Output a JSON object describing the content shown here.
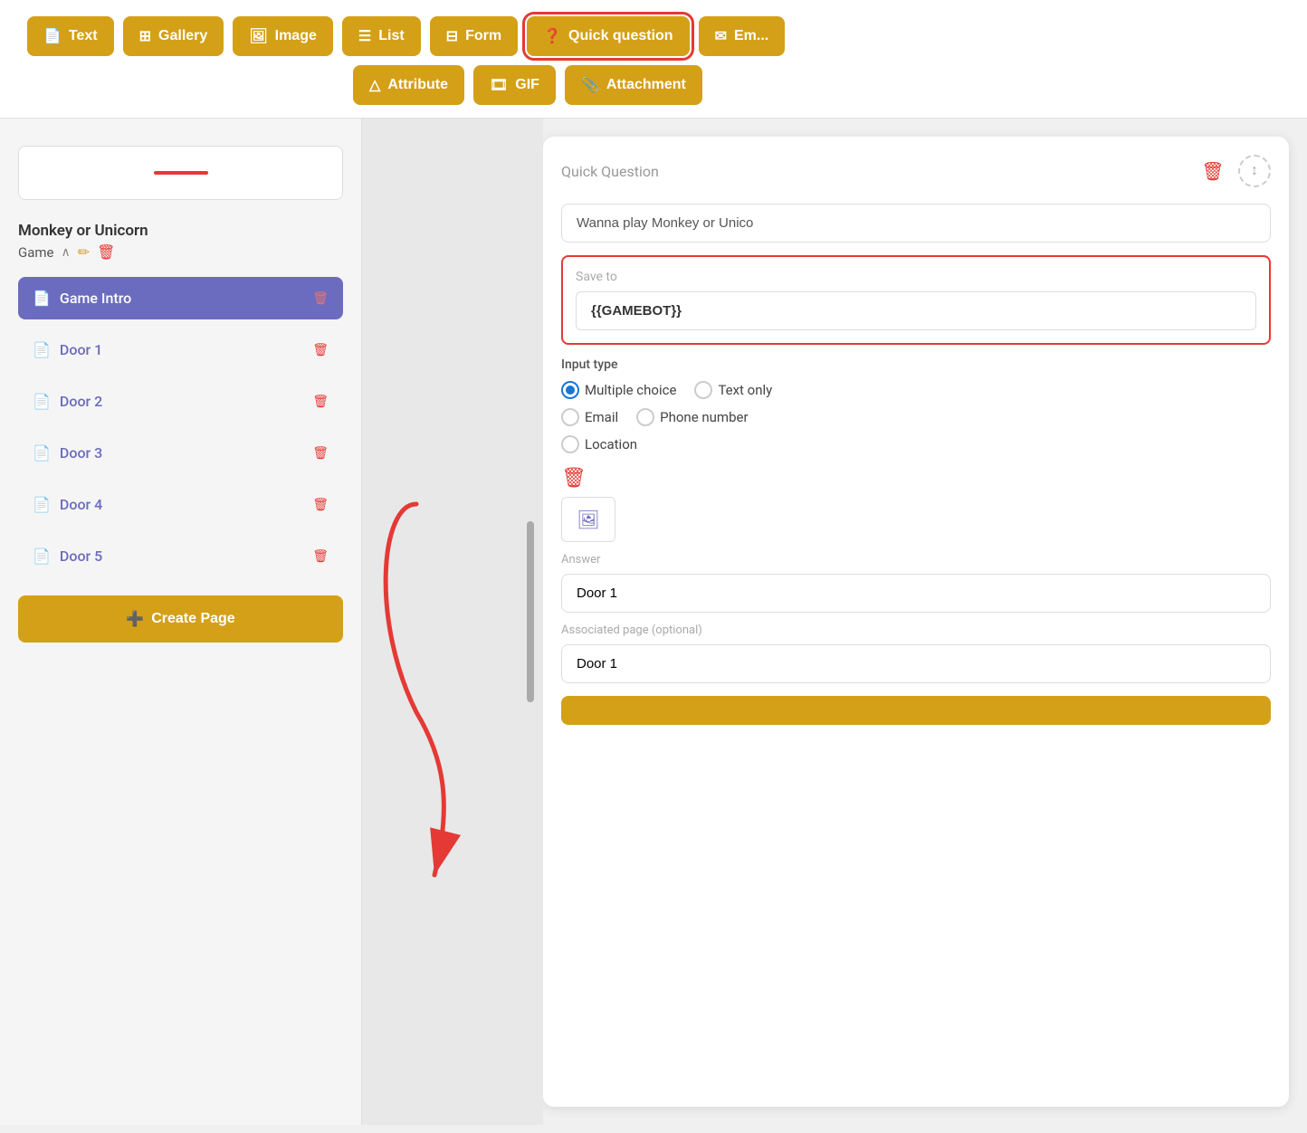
{
  "toolbar": {
    "row1": [
      {
        "id": "text",
        "label": "Text",
        "icon": "📄"
      },
      {
        "id": "gallery",
        "label": "Gallery",
        "icon": "⊞"
      },
      {
        "id": "image",
        "label": "Image",
        "icon": "🖼"
      },
      {
        "id": "list",
        "label": "List",
        "icon": "☰"
      },
      {
        "id": "form",
        "label": "Form",
        "icon": "⊟"
      },
      {
        "id": "quick-question",
        "label": "Quick question",
        "icon": "❓",
        "highlighted": true
      },
      {
        "id": "email",
        "label": "Em...",
        "icon": "✉"
      }
    ],
    "row2": [
      {
        "id": "attribute",
        "label": "Attribute",
        "icon": "△"
      },
      {
        "id": "gif",
        "label": "GIF",
        "icon": "🎞"
      },
      {
        "id": "attachment",
        "label": "Attachment",
        "icon": "📎"
      }
    ]
  },
  "sidebar": {
    "project_name": "Monkey or Unicorn",
    "project_subtitle": "Game",
    "pages": [
      {
        "id": "game-intro",
        "label": "Game Intro",
        "active": true
      },
      {
        "id": "door-1",
        "label": "Door 1",
        "active": false
      },
      {
        "id": "door-2",
        "label": "Door 2",
        "active": false
      },
      {
        "id": "door-3",
        "label": "Door 3",
        "active": false
      },
      {
        "id": "door-4",
        "label": "Door 4",
        "active": false
      },
      {
        "id": "door-5",
        "label": "Door 5",
        "active": false
      }
    ],
    "create_page_label": "Create Page"
  },
  "quick_question_panel": {
    "title": "Quick Question",
    "question_placeholder": "Wanna play Monkey or Unico",
    "save_to_label": "Save to",
    "save_to_value": "{{GAMEBOT}}",
    "input_type_label": "Input type",
    "input_types": [
      {
        "id": "multiple-choice",
        "label": "Multiple choice",
        "selected": true
      },
      {
        "id": "text-only",
        "label": "Text only",
        "selected": false
      },
      {
        "id": "email",
        "label": "Email",
        "selected": false
      },
      {
        "id": "phone-number",
        "label": "Phone number",
        "selected": false
      },
      {
        "id": "location",
        "label": "Location",
        "selected": false
      }
    ],
    "answer_label": "Answer",
    "answer_value": "Door 1",
    "associated_page_label": "Associated page (optional)",
    "associated_page_value": "Door 1"
  }
}
